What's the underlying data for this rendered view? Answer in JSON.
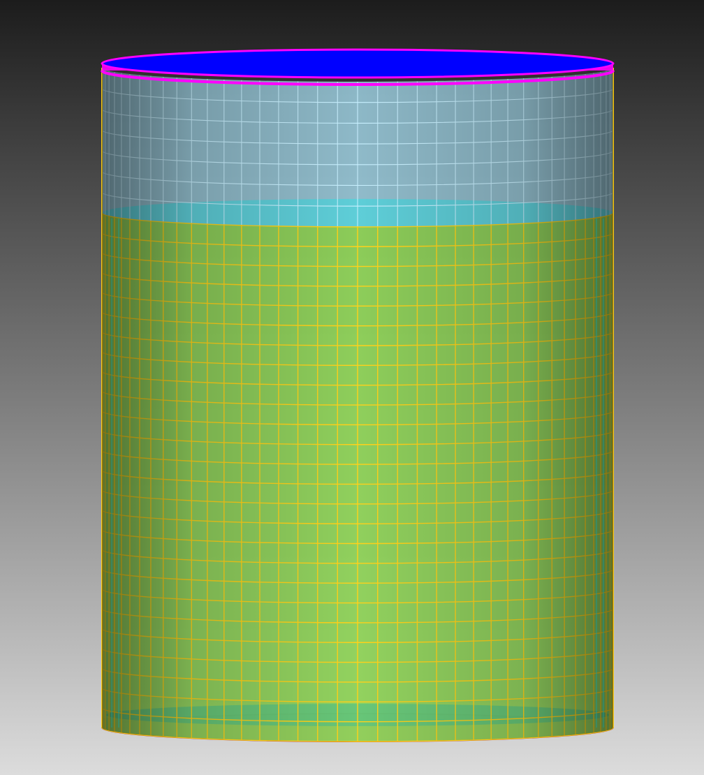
{
  "viewport": {
    "background_top": "#1c1c1c",
    "background_bottom": "#dcdcdc"
  },
  "model": {
    "shape": "cylinder-tank-mesh",
    "liquid_fill_fraction": 0.78,
    "colors": {
      "top_cap": "#0000ff",
      "top_rim": "#ff00ff",
      "upper_shell_fill": "#9ccfe0",
      "upper_shell_grid": "#c8f0ff",
      "liquid_surface": "#5ccfd8",
      "liquid_fill": "#8fd35a",
      "liquid_grid": "#ffd21a",
      "inner_edge": "#33ffee",
      "bottom_cap": "#b88080",
      "bottom_rim": "#a02020"
    }
  }
}
